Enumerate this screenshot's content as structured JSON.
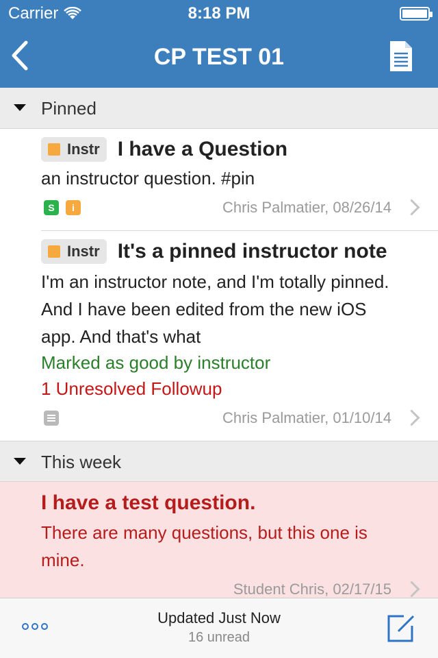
{
  "status": {
    "carrier": "Carrier",
    "time": "8:18 PM",
    "battery_level": 1.0
  },
  "nav": {
    "title": "CP TEST 01",
    "back_icon": "chevron-left-icon",
    "right_icon": "document-icon"
  },
  "sections": [
    {
      "label": "Pinned",
      "posts": [
        {
          "badge": "Instr",
          "title": "I have a Question",
          "body": "an instructor question. #pin",
          "tags": [
            "S",
            "i"
          ],
          "meta": "Chris Palmatier, 08/26/14"
        },
        {
          "badge": "Instr",
          "title": "It's a pinned instructor note",
          "body": "I'm an instructor note, and I'm totally pinned. And I have been edited from the new iOS app. And that's what",
          "good": "Marked as good by instructor",
          "followup": "1 Unresolved Followup",
          "meta": "Chris Palmatier, 01/10/14"
        }
      ]
    },
    {
      "label": "This week",
      "posts": [
        {
          "title": "I have a test question.",
          "body": "There are many questions, but this one is mine.",
          "meta": "Student Chris, 02/17/15"
        }
      ]
    }
  ],
  "footer": {
    "updated": "Updated Just Now",
    "unread": "16 unread"
  },
  "colors": {
    "navbar": "#3d7fbd",
    "unread_row": "#fbe1e2",
    "unread_text": "#b51c1c",
    "good": "#2a7f2a",
    "followup": "#c41616",
    "instr_square": "#f5a93f",
    "tag_s": "#2bb24c",
    "tag_i": "#f5a93f",
    "link": "#2e74c6"
  }
}
